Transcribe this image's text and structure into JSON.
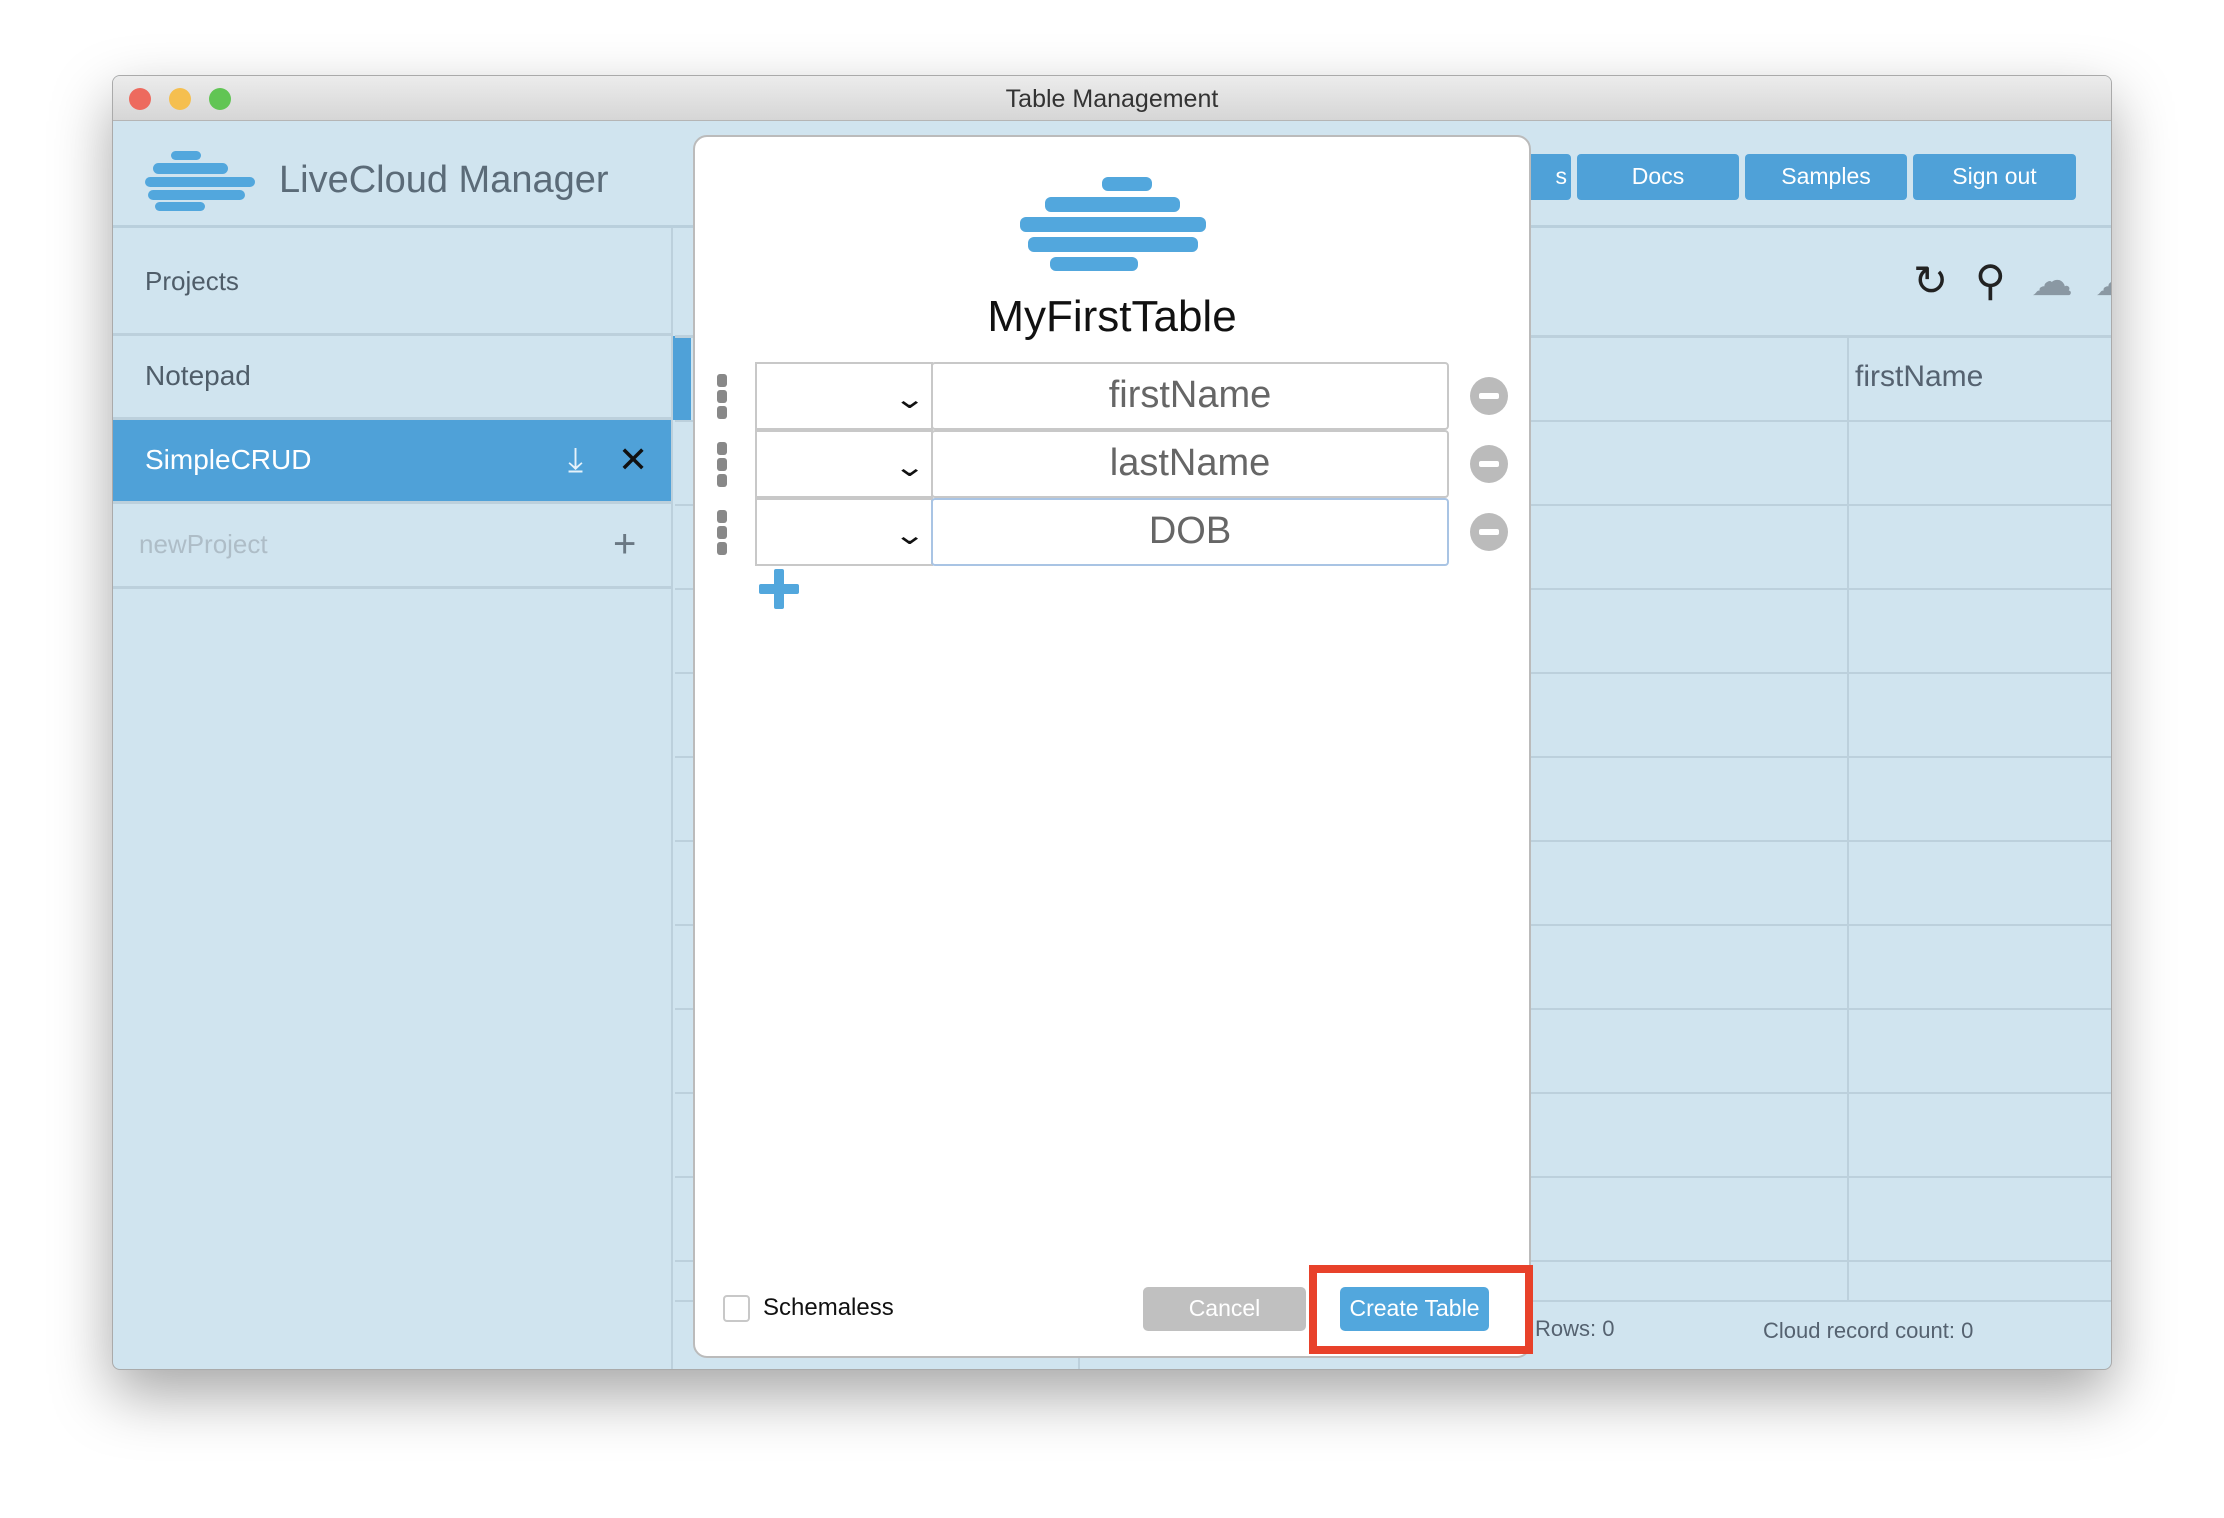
{
  "window": {
    "title": "Table Management"
  },
  "header": {
    "app_name": "LiveCloud Manager",
    "buttons": [
      "s",
      "Docs",
      "Samples",
      "Sign out"
    ]
  },
  "sidebar": {
    "heading": "Projects",
    "items": [
      {
        "label": "Notepad"
      },
      {
        "label": "SimpleCRUD",
        "selected": true
      },
      {
        "label": "newProject",
        "placeholder": true
      }
    ]
  },
  "toolbar": {
    "icons": [
      "refresh-icon",
      "search-icon",
      "cloud-download-icon",
      "cloud-upload-icon",
      "split-view-icon"
    ]
  },
  "table": {
    "columns": [
      "firstName"
    ],
    "rows_label": "Rows: 0",
    "cloud_count": "Cloud record count: 0"
  },
  "dialog": {
    "title": "MyFirstTable",
    "fields": [
      {
        "type": "",
        "name": "firstName"
      },
      {
        "type": "",
        "name": "lastName"
      },
      {
        "type": "",
        "name": "DOB"
      }
    ],
    "schemaless_label": "Schemaless",
    "schemaless_checked": false,
    "cancel_label": "Cancel",
    "create_label": "Create Table"
  },
  "colors": {
    "accent": "#4fa1d8",
    "background": "#d0e4ef",
    "highlight": "#e8412a"
  }
}
